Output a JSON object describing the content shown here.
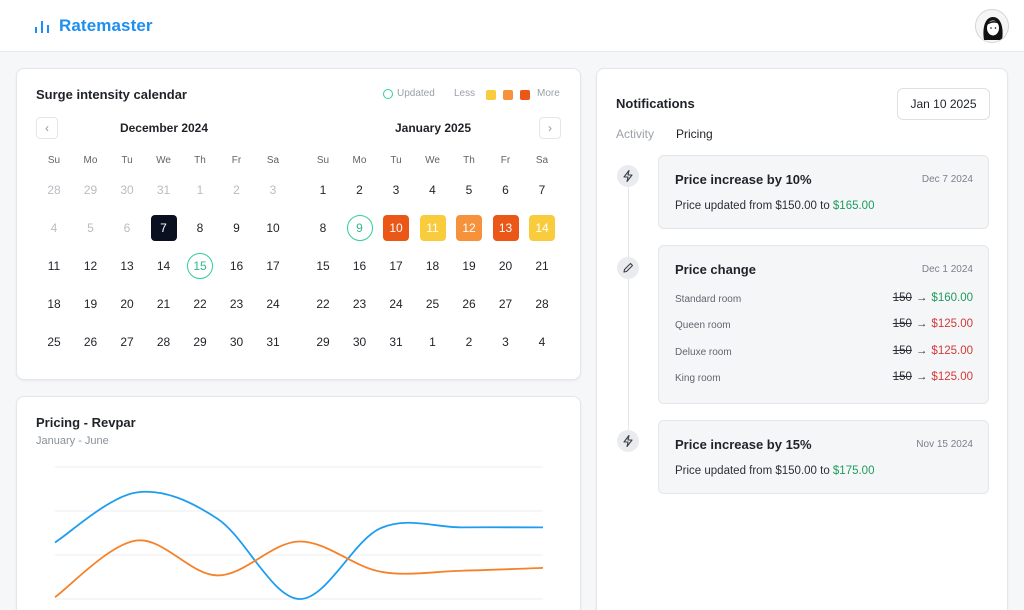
{
  "app": {
    "brand": "Ratemaster"
  },
  "calendar": {
    "title": "Surge intensity calendar",
    "legend": {
      "updated": "Updated",
      "less": "Less",
      "more": "More",
      "colors": [
        "#f9cc3e",
        "#f5923b",
        "#ea5716"
      ]
    },
    "weekdays": [
      "Su",
      "Mo",
      "Tu",
      "We",
      "Th",
      "Fr",
      "Sa"
    ],
    "months": [
      {
        "title": "December 2024",
        "days": [
          {
            "d": "28",
            "m": 1
          },
          {
            "d": "29",
            "m": 1
          },
          {
            "d": "30",
            "m": 1
          },
          {
            "d": "31",
            "m": 1
          },
          {
            "d": "1",
            "m": 1
          },
          {
            "d": "2",
            "m": 1
          },
          {
            "d": "3",
            "m": 1
          },
          {
            "d": "4",
            "m": 1
          },
          {
            "d": "5",
            "m": 1
          },
          {
            "d": "6",
            "m": 1
          },
          {
            "d": "7",
            "s": 1
          },
          {
            "d": "8"
          },
          {
            "d": "9"
          },
          {
            "d": "10"
          },
          {
            "d": "11"
          },
          {
            "d": "12"
          },
          {
            "d": "13"
          },
          {
            "d": "14"
          },
          {
            "d": "15",
            "u": 1
          },
          {
            "d": "16"
          },
          {
            "d": "17"
          },
          {
            "d": "18"
          },
          {
            "d": "19"
          },
          {
            "d": "20"
          },
          {
            "d": "21"
          },
          {
            "d": "22"
          },
          {
            "d": "23"
          },
          {
            "d": "24"
          },
          {
            "d": "25"
          },
          {
            "d": "26"
          },
          {
            "d": "27"
          },
          {
            "d": "28"
          },
          {
            "d": "29"
          },
          {
            "d": "30"
          },
          {
            "d": "31"
          }
        ]
      },
      {
        "title": "January 2025",
        "days": [
          {
            "d": "1"
          },
          {
            "d": "2"
          },
          {
            "d": "3"
          },
          {
            "d": "4"
          },
          {
            "d": "5"
          },
          {
            "d": "6"
          },
          {
            "d": "7"
          },
          {
            "d": "8"
          },
          {
            "d": "9",
            "u": 1
          },
          {
            "d": "10",
            "h": "#ea5716"
          },
          {
            "d": "11",
            "h": "#f9cc3e"
          },
          {
            "d": "12",
            "h": "#f5923b"
          },
          {
            "d": "13",
            "h": "#ea5716"
          },
          {
            "d": "14",
            "h": "#f9cc3e"
          },
          {
            "d": "15"
          },
          {
            "d": "16"
          },
          {
            "d": "17"
          },
          {
            "d": "18"
          },
          {
            "d": "19"
          },
          {
            "d": "20"
          },
          {
            "d": "21"
          },
          {
            "d": "22"
          },
          {
            "d": "23"
          },
          {
            "d": "24"
          },
          {
            "d": "25"
          },
          {
            "d": "26"
          },
          {
            "d": "27"
          },
          {
            "d": "28"
          },
          {
            "d": "29"
          },
          {
            "d": "30"
          },
          {
            "d": "31"
          },
          {
            "d": "1"
          },
          {
            "d": "2"
          },
          {
            "d": "3"
          },
          {
            "d": "4"
          }
        ]
      }
    ]
  },
  "revpar": {
    "title": "Pricing - Revpar",
    "subtitle": "January - June"
  },
  "chart_data": {
    "type": "line",
    "title": "Pricing - Revpar",
    "x": [
      0,
      1,
      2,
      3,
      4,
      5,
      6
    ],
    "ylim": [
      0,
      140
    ],
    "grid": true,
    "series": [
      {
        "color": "#1e9df0",
        "values": [
          60,
          113,
          85,
          0,
          75,
          76,
          76
        ]
      },
      {
        "color": "#f5822a",
        "values": [
          2,
          62,
          25,
          61,
          29,
          30,
          33
        ]
      }
    ]
  },
  "notifications": {
    "title": "Notifications",
    "date": "Jan 10 2025",
    "tabs": [
      "Activity",
      "Pricing"
    ],
    "items": [
      {
        "title": "Price increase by 10%",
        "date": "Dec 7 2024",
        "text_prefix": "Price updated from $150.00 to ",
        "text_new": "$165.00"
      },
      {
        "title": "Price change",
        "date": "Dec 1 2024",
        "rooms": [
          {
            "name": "Standard room",
            "old": "150",
            "arrow": "→",
            "new": "$160.00"
          },
          {
            "name": "Queen room",
            "old": "150",
            "arrow": "→",
            "new": "$125.00"
          },
          {
            "name": "Deluxe room",
            "old": "150",
            "arrow": "→",
            "new": "$125.00"
          },
          {
            "name": "King room",
            "old": "150",
            "arrow": "→",
            "new": "$125.00"
          }
        ]
      },
      {
        "title": "Price increase by 15%",
        "date": "Nov 15 2024",
        "text_prefix": "Price updated from $150.00 to ",
        "text_new": "$175.00"
      }
    ]
  }
}
